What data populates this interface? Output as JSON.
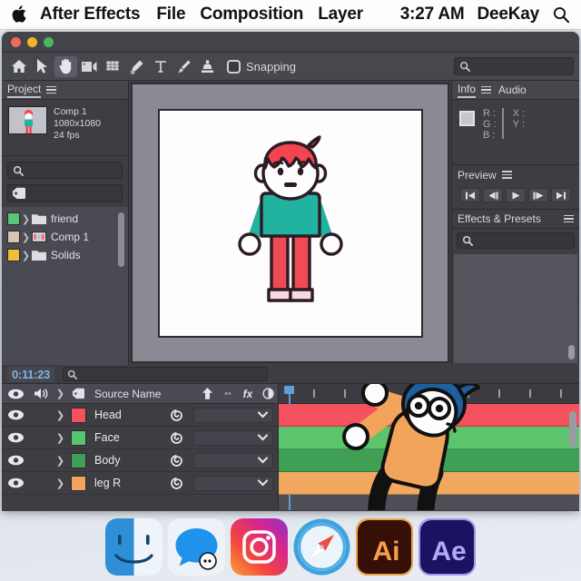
{
  "menubar": {
    "apple_icon": "apple-logo",
    "items": [
      "After Effects",
      "File",
      "Composition",
      "Layer"
    ],
    "time": "3:27 AM",
    "user": "DeeKay",
    "search_icon": "search-icon"
  },
  "window": {
    "traffic_lights": [
      "close",
      "minimize",
      "zoom"
    ]
  },
  "toolbar": {
    "tools": [
      {
        "name": "home-icon",
        "label": "Home"
      },
      {
        "name": "selection-arrow-icon",
        "label": "Selection Tool"
      },
      {
        "name": "hand-icon",
        "label": "Hand Tool"
      },
      {
        "name": "zoom-camera-icon",
        "label": "Camera Tool"
      },
      {
        "name": "grid-rect-icon",
        "label": "Shape Tool"
      },
      {
        "name": "pen-icon",
        "label": "Pen Tool"
      },
      {
        "name": "text-icon",
        "label": "Type Tool"
      },
      {
        "name": "brush-icon",
        "label": "Brush Tool"
      },
      {
        "name": "clone-stamp-icon",
        "label": "Clone Stamp Tool"
      }
    ],
    "snapping_label": "Snapping",
    "snapping_checked": false,
    "search_icon": "search-icon",
    "search_value": "",
    "search_placeholder": ""
  },
  "project": {
    "tab_label": "Project",
    "menu_icon": "panel-menu-icon",
    "comp_name": "Comp 1",
    "comp_resolution": "1080x1080",
    "comp_fps": "24 fps",
    "thumbnail_name": "comp-thumbnail",
    "search_icon": "search-icon",
    "search_value": "",
    "tag_icon": "tag-icon",
    "items": [
      {
        "label": "friend",
        "color": "#5ac47a",
        "icon": "folder-icon"
      },
      {
        "label": "Comp 1",
        "color": "#d6c3b0",
        "icon": "composition-icon"
      },
      {
        "label": "Solids",
        "color": "#f0c03a",
        "icon": "folder-icon"
      }
    ]
  },
  "viewer": {
    "canvas_name": "composition-canvas",
    "character": {
      "hair": "#f4444f",
      "skin": "#fdfdfd",
      "shirt": "#22b3a0",
      "pants": "#ef4b54",
      "shoes": "#f7d9e0",
      "outline": "#2d1b24"
    }
  },
  "info_panel": {
    "tabs": [
      "Info",
      "Audio"
    ],
    "selected_tab": "Info",
    "menu_icon": "panel-menu-icon",
    "swatch_name": "color-swatch",
    "channels": [
      "R :",
      "G :",
      "B :"
    ],
    "coords": [
      "X :",
      "Y :"
    ]
  },
  "preview_panel": {
    "title": "Preview",
    "menu_icon": "panel-menu-icon",
    "buttons": [
      {
        "name": "first-frame-button",
        "glyph": "first"
      },
      {
        "name": "previous-frame-button",
        "glyph": "prev"
      },
      {
        "name": "play-button",
        "glyph": "play"
      },
      {
        "name": "next-frame-button",
        "glyph": "next"
      },
      {
        "name": "last-frame-button",
        "glyph": "last"
      }
    ]
  },
  "effects_panel": {
    "title": "Effects & Presets",
    "menu_icon": "panel-menu-icon",
    "search_icon": "search-icon",
    "search_value": ""
  },
  "timeline": {
    "timecode": "0:11:23",
    "search_icon": "search-icon",
    "search_value": "",
    "columns": {
      "eye": "visibility-icon",
      "audio": "audio-icon",
      "solo": "solo-icon",
      "lock": "lock-icon",
      "source_name": "Source Name",
      "parent_icon": "parent-arrow-icon",
      "fx": "fx",
      "adjust": "adjustment-icon"
    },
    "layers": [
      {
        "name": "Head",
        "color": "#f4525e",
        "bar_color": "#f4525e",
        "parent": "",
        "visible": true
      },
      {
        "name": "Face",
        "color": "#57c46f",
        "bar_color": "#5dc46e",
        "parent": "",
        "visible": true
      },
      {
        "name": "Body",
        "color": "#3f9f54",
        "bar_color": "#3f9f54",
        "parent": "",
        "visible": true
      },
      {
        "name": "leg R",
        "color": "#f0a45e",
        "bar_color": "#f2a95f",
        "parent": "",
        "visible": true
      }
    ],
    "ruler_ticks": 9,
    "playhead_position": "0"
  },
  "timeline_character": {
    "hair": "#1f5fa0",
    "skin": "#fdfdfd",
    "shirt": "#f2a45a",
    "pants": "#1f5490",
    "shoes": "#e8eef5",
    "outline": "#111111"
  },
  "dock": {
    "items": [
      {
        "name": "finder-icon",
        "label": "Finder"
      },
      {
        "name": "messages-icon",
        "label": "Messages"
      },
      {
        "name": "instagram-icon",
        "label": "Instagram"
      },
      {
        "name": "safari-icon",
        "label": "Safari"
      },
      {
        "name": "illustrator-icon",
        "label": "Ai"
      },
      {
        "name": "after-effects-icon",
        "label": "Ae"
      }
    ]
  }
}
